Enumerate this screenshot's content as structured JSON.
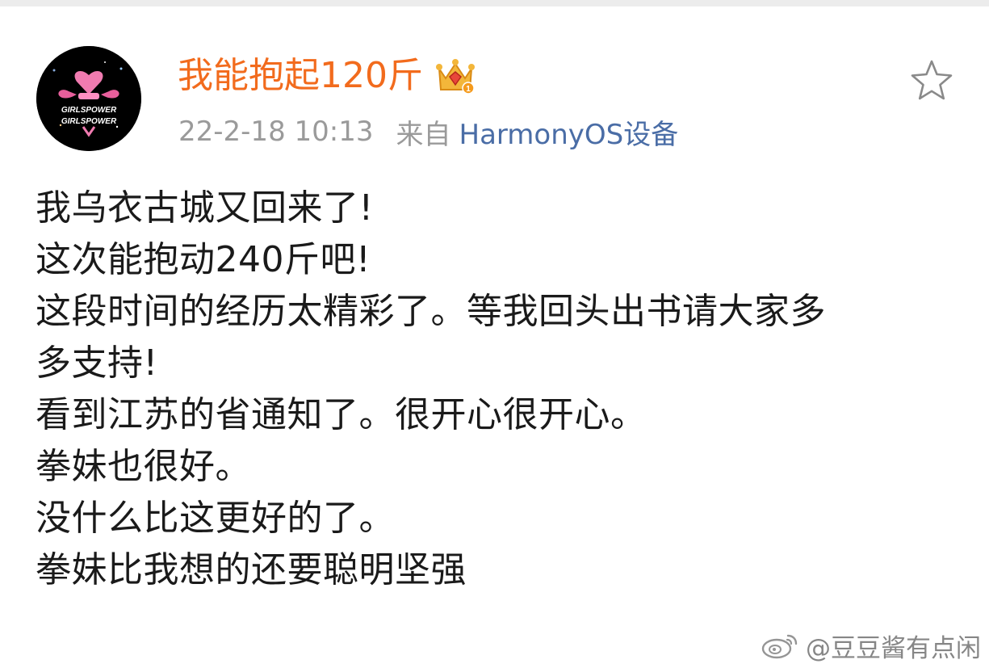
{
  "post": {
    "author": {
      "username": "我能抱起120斤",
      "avatar_text_line1": "GIRLSPOWER",
      "avatar_text_line2": "GIRLSPOWER",
      "badge_icon": "crown-icon"
    },
    "meta": {
      "timestamp": "22-2-18 10:13",
      "source_prefix": "来自",
      "source_device": "HarmonyOS设备"
    },
    "favorite_icon": "star-icon",
    "body_lines": [
      "我乌衣古城又回来了!",
      "这次能抱动240斤吧!",
      "这段时间的经历太精彩了。等我回头出书请大家多",
      "多支持!",
      "看到江苏的省通知了。很开心很开心。",
      "拳妹也很好。",
      "没什么比这更好的了。",
      "拳妹比我想的还要聪明坚强"
    ]
  },
  "watermark": {
    "handle": "@豆豆酱有点闲",
    "icon": "weibo-icon"
  },
  "colors": {
    "username": "#f26b1d",
    "meta_gray": "#9a9a9a",
    "source_link": "#4a6da6",
    "body_text": "#1a1a1a"
  }
}
